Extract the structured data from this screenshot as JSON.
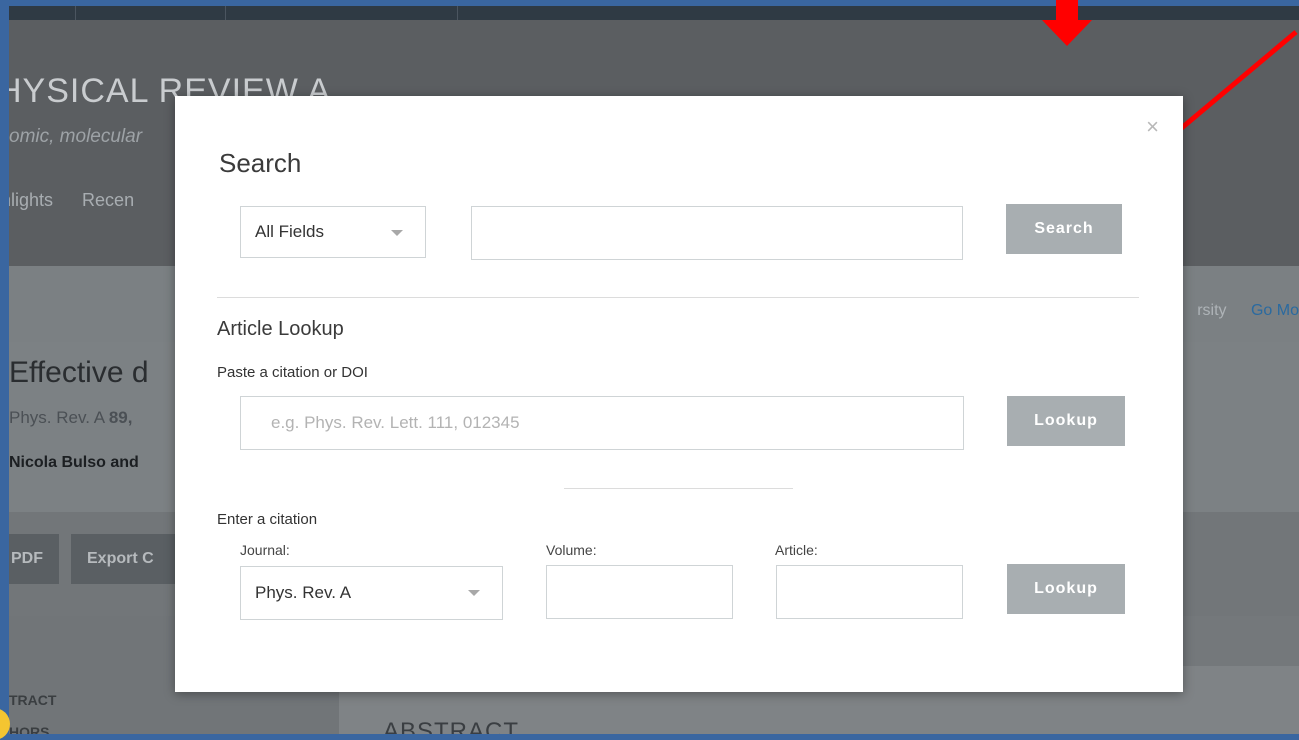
{
  "background_page": {
    "journal_title": "HYSICAL REVIEW A",
    "journal_subtitle": "omic, molecular",
    "nav": [
      "hlights",
      "Recen"
    ],
    "subnav_institution": "rsity",
    "subnav_link": "Go Mo",
    "article_title": "Effective d",
    "article_ref_prefix": "Phys. Rev. A ",
    "article_ref_vol": "89,",
    "article_authors": "Nicola Bulso and",
    "pdf_button": "PDF",
    "export_button": "Export C",
    "side_links": [
      "TRACT",
      "HORS"
    ],
    "abstract_heading": "ABSTRACT"
  },
  "modal": {
    "close_glyph": "×",
    "search_heading": "Search",
    "field_select_value": "All Fields",
    "search_input_value": "",
    "search_button": "Search",
    "lookup_heading": "Article Lookup",
    "paste_label": "Paste a citation or DOI",
    "citation_placeholder": "e.g. Phys. Rev. Lett. 111, 012345",
    "lookup_button": "Lookup",
    "enter_label": "Enter a citation",
    "journal_label": "Journal:",
    "journal_value": "Phys. Rev. A",
    "volume_label": "Volume:",
    "article_label": "Article:",
    "lookup_button_2": "Lookup"
  },
  "colors": {
    "annotation_red": "#ff0000",
    "button_gray": "#a8aeb1",
    "link_blue": "#2a6aa0"
  }
}
